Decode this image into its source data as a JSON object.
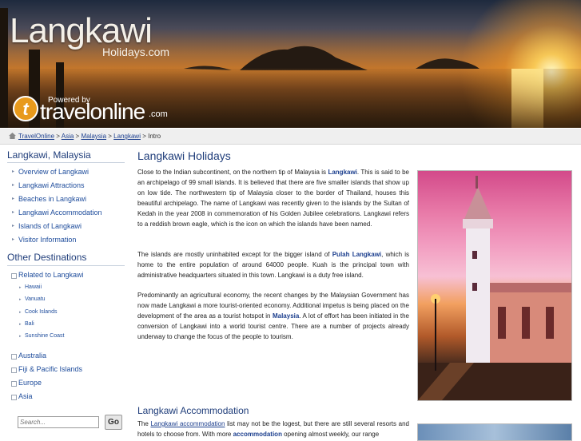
{
  "header": {
    "logo_title": "Langkawi",
    "logo_sub": "Holidays.com",
    "powered_by": "Powered by",
    "travelonline": "travelonline",
    "travelonline_com": ".com",
    "to_mark": "t"
  },
  "breadcrumb": {
    "items": [
      "TravelOnline",
      "Asia",
      "Malaysia",
      "Langkawi"
    ],
    "separator": ">",
    "current": "Intro"
  },
  "sidebar": {
    "heading1": "Langkawi, Malaysia",
    "links": [
      "Overview of Langkawi",
      "Langkawi Attractions",
      "Beaches in Langkawi",
      "Langkawi Accommodation",
      "Islands of Langkawi",
      "Visitor Information"
    ],
    "heading2": "Other Destinations",
    "related": "Related to Langkawi",
    "related_sub": [
      "Hawaii",
      "Vanuatu",
      "Cook Islands",
      "Bali",
      "Sunshine Coast"
    ],
    "regions": [
      "Australia",
      "Fiji & Pacific Islands",
      "Europe",
      "Asia"
    ],
    "search_placeholder": "Search...",
    "search_button": "Go"
  },
  "main": {
    "title": "Langkawi Holidays",
    "p1_a": "Close to the Indian subcontinent, on the northern tip of Malaysia is ",
    "p1_link": "Langkawi",
    "p1_b": ". This is said to be an archipelago of 99 small islands. It is believed that there are five smaller islands that show up on low tide. The northwestern tip of Malaysia closer to the border of Thailand, houses this beautiful archipelago. The name of Langkawi was recently given to the islands by the Sultan of Kedah in the year 2008 in commemoration of his Golden Jubilee celebrations. Langkawi refers to a reddish brown eagle, which is the icon on which the islands have been named.",
    "p2_a": "The islands are mostly uninhabited except for the bigger island of ",
    "p2_link": "Pulah Langkawi",
    "p2_b": ", which is home to the entire population of around 64000 people. Kuah is the principal town with administrative headquarters situated in this town. Langkawi is a duty free island.",
    "p3_a": "Predominantly an agricultural economy, the recent changes by the Malaysian Government has now made Langkawi a more tourist-oriented economy. Additional impetus is being placed on the development of the area as a tourist hotspot in ",
    "p3_link": "Malaysia",
    "p3_b": ". A lot of effort has been initiated in the conversion of Langkawi into a world tourist centre. There are a number of projects already underway to change the focus of the people to tourism.",
    "sec2_title": "Langkawi Accommodation",
    "p4_a": "The ",
    "p4_link": "Langkawi accommodation",
    "p4_b": " list may not be the logest, but there are still several resorts and hotels to choose from. With more ",
    "p4_link2": "accommodation",
    "p4_c": " opening almost weekly, our range"
  },
  "colors": {
    "heading": "#1f3d7a",
    "link": "#1c3f8e",
    "breadcrumb_bg": "#efefef"
  },
  "icons": {
    "home": "home-icon",
    "arrow": "triangle-right-icon",
    "expand": "plus-box-icon"
  }
}
